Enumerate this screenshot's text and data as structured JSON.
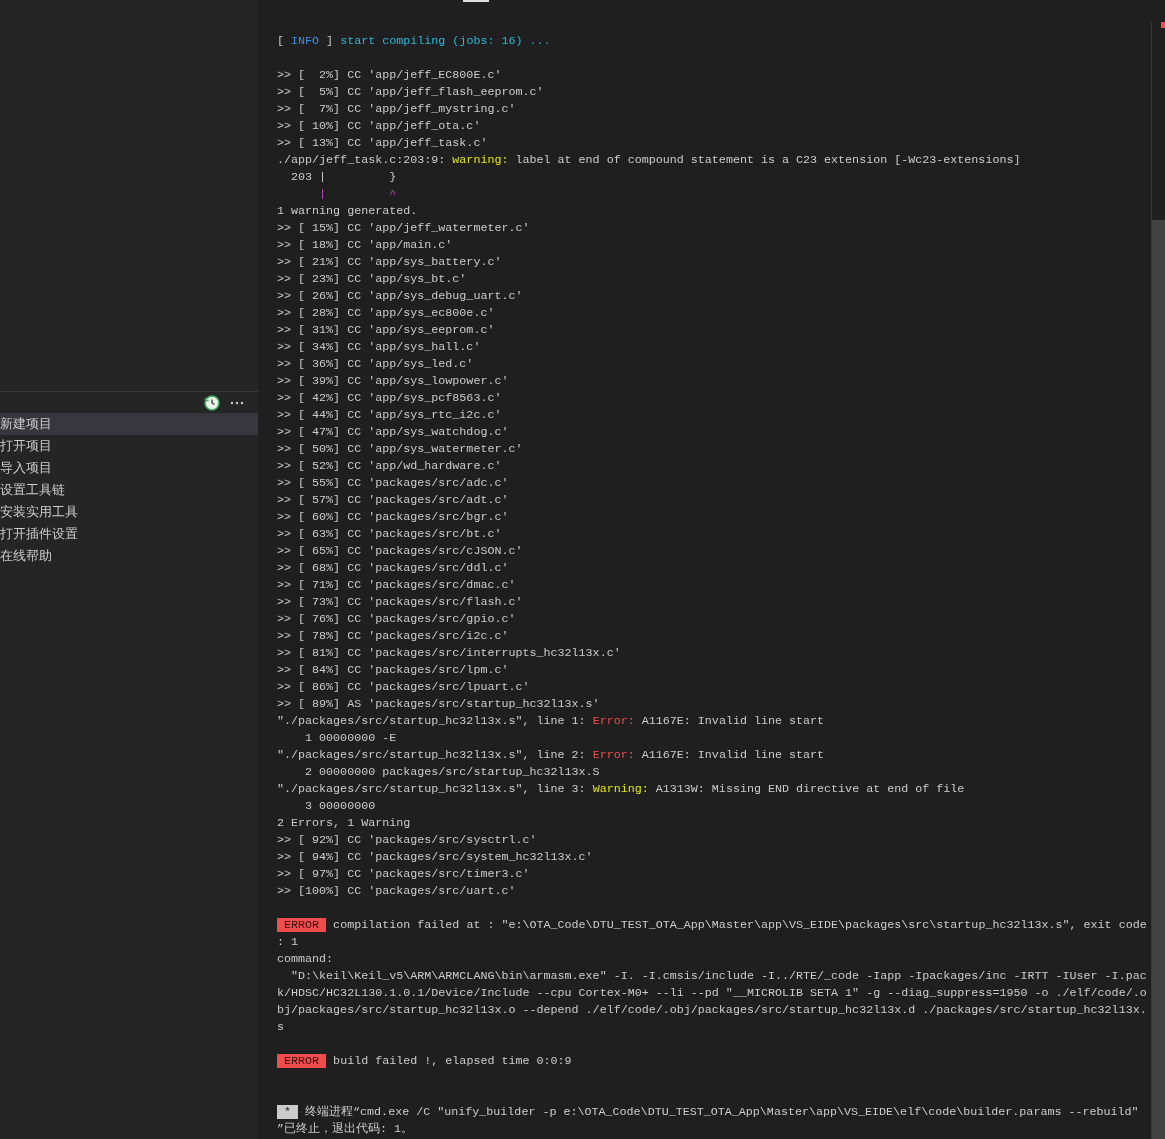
{
  "sidebar": {
    "items": [
      {
        "label": "新建项目",
        "selected": true
      },
      {
        "label": "打开项目",
        "selected": false
      },
      {
        "label": "导入项目",
        "selected": false
      },
      {
        "label": "设置工具链",
        "selected": false
      },
      {
        "label": "安装实用工具",
        "selected": false
      },
      {
        "label": "打开插件设置",
        "selected": false
      },
      {
        "label": "在线帮助",
        "selected": false
      }
    ]
  },
  "terminal": {
    "lines": [
      {
        "segments": [
          {
            "kind": "plain",
            "text": "[ "
          },
          {
            "kind": "info",
            "text": "INFO"
          },
          {
            "kind": "plain",
            "text": " ] "
          },
          {
            "kind": "cyan",
            "text": "start compiling (jobs: 16) ..."
          }
        ]
      },
      {
        "kind": "blank"
      },
      {
        "segments": [
          {
            "kind": "plain",
            "text": ">> [  2%] CC 'app/jeff_EC800E.c'"
          }
        ]
      },
      {
        "segments": [
          {
            "kind": "plain",
            "text": ">> [  5%] CC 'app/jeff_flash_eeprom.c'"
          }
        ]
      },
      {
        "segments": [
          {
            "kind": "plain",
            "text": ">> [  7%] CC 'app/jeff_mystring.c'"
          }
        ]
      },
      {
        "segments": [
          {
            "kind": "plain",
            "text": ">> [ 10%] CC 'app/jeff_ota.c'"
          }
        ]
      },
      {
        "segments": [
          {
            "kind": "plain",
            "text": ">> [ 13%] CC 'app/jeff_task.c'"
          }
        ]
      },
      {
        "segments": [
          {
            "kind": "plain",
            "text": "./app/jeff_task.c:203:9: "
          },
          {
            "kind": "warning",
            "text": "warning:"
          },
          {
            "kind": "plain",
            "text": " label at end of compound statement is a C23 extension [-Wc23-extensions]"
          }
        ]
      },
      {
        "segments": [
          {
            "kind": "plain",
            "text": "  203 |         }"
          }
        ]
      },
      {
        "segments": [
          {
            "kind": "marker",
            "text": "      |         ^"
          }
        ]
      },
      {
        "segments": [
          {
            "kind": "plain",
            "text": "1 warning generated."
          }
        ]
      },
      {
        "segments": [
          {
            "kind": "plain",
            "text": ">> [ 15%] CC 'app/jeff_watermeter.c'"
          }
        ]
      },
      {
        "segments": [
          {
            "kind": "plain",
            "text": ">> [ 18%] CC 'app/main.c'"
          }
        ]
      },
      {
        "segments": [
          {
            "kind": "plain",
            "text": ">> [ 21%] CC 'app/sys_battery.c'"
          }
        ]
      },
      {
        "segments": [
          {
            "kind": "plain",
            "text": ">> [ 23%] CC 'app/sys_bt.c'"
          }
        ]
      },
      {
        "segments": [
          {
            "kind": "plain",
            "text": ">> [ 26%] CC 'app/sys_debug_uart.c'"
          }
        ]
      },
      {
        "segments": [
          {
            "kind": "plain",
            "text": ">> [ 28%] CC 'app/sys_ec800e.c'"
          }
        ]
      },
      {
        "segments": [
          {
            "kind": "plain",
            "text": ">> [ 31%] CC 'app/sys_eeprom.c'"
          }
        ]
      },
      {
        "segments": [
          {
            "kind": "plain",
            "text": ">> [ 34%] CC 'app/sys_hall.c'"
          }
        ]
      },
      {
        "segments": [
          {
            "kind": "plain",
            "text": ">> [ 36%] CC 'app/sys_led.c'"
          }
        ]
      },
      {
        "segments": [
          {
            "kind": "plain",
            "text": ">> [ 39%] CC 'app/sys_lowpower.c'"
          }
        ]
      },
      {
        "segments": [
          {
            "kind": "plain",
            "text": ">> [ 42%] CC 'app/sys_pcf8563.c'"
          }
        ]
      },
      {
        "segments": [
          {
            "kind": "plain",
            "text": ">> [ 44%] CC 'app/sys_rtc_i2c.c'"
          }
        ]
      },
      {
        "segments": [
          {
            "kind": "plain",
            "text": ">> [ 47%] CC 'app/sys_watchdog.c'"
          }
        ]
      },
      {
        "segments": [
          {
            "kind": "plain",
            "text": ">> [ 50%] CC 'app/sys_watermeter.c'"
          }
        ]
      },
      {
        "segments": [
          {
            "kind": "plain",
            "text": ">> [ 52%] CC 'app/wd_hardware.c'"
          }
        ]
      },
      {
        "segments": [
          {
            "kind": "plain",
            "text": ">> [ 55%] CC 'packages/src/adc.c'"
          }
        ]
      },
      {
        "segments": [
          {
            "kind": "plain",
            "text": ">> [ 57%] CC 'packages/src/adt.c'"
          }
        ]
      },
      {
        "segments": [
          {
            "kind": "plain",
            "text": ">> [ 60%] CC 'packages/src/bgr.c'"
          }
        ]
      },
      {
        "segments": [
          {
            "kind": "plain",
            "text": ">> [ 63%] CC 'packages/src/bt.c'"
          }
        ]
      },
      {
        "segments": [
          {
            "kind": "plain",
            "text": ">> [ 65%] CC 'packages/src/cJSON.c'"
          }
        ]
      },
      {
        "segments": [
          {
            "kind": "plain",
            "text": ">> [ 68%] CC 'packages/src/ddl.c'"
          }
        ]
      },
      {
        "segments": [
          {
            "kind": "plain",
            "text": ">> [ 71%] CC 'packages/src/dmac.c'"
          }
        ]
      },
      {
        "segments": [
          {
            "kind": "plain",
            "text": ">> [ 73%] CC 'packages/src/flash.c'"
          }
        ]
      },
      {
        "segments": [
          {
            "kind": "plain",
            "text": ">> [ 76%] CC 'packages/src/gpio.c'"
          }
        ]
      },
      {
        "segments": [
          {
            "kind": "plain",
            "text": ">> [ 78%] CC 'packages/src/i2c.c'"
          }
        ]
      },
      {
        "segments": [
          {
            "kind": "plain",
            "text": ">> [ 81%] CC 'packages/src/interrupts_hc32l13x.c'"
          }
        ]
      },
      {
        "segments": [
          {
            "kind": "plain",
            "text": ">> [ 84%] CC 'packages/src/lpm.c'"
          }
        ]
      },
      {
        "segments": [
          {
            "kind": "plain",
            "text": ">> [ 86%] CC 'packages/src/lpuart.c'"
          }
        ]
      },
      {
        "segments": [
          {
            "kind": "plain",
            "text": ">> [ 89%] AS 'packages/src/startup_hc32l13x.s'"
          }
        ]
      },
      {
        "segments": [
          {
            "kind": "plain",
            "text": "\"./packages/src/startup_hc32l13x.s\", line 1: "
          },
          {
            "kind": "error",
            "text": "Error:"
          },
          {
            "kind": "plain",
            "text": " A1167E: Invalid line start"
          }
        ]
      },
      {
        "segments": [
          {
            "kind": "plain",
            "text": "    1 00000000 -E"
          }
        ]
      },
      {
        "segments": [
          {
            "kind": "plain",
            "text": "\"./packages/src/startup_hc32l13x.s\", line 2: "
          },
          {
            "kind": "error",
            "text": "Error:"
          },
          {
            "kind": "plain",
            "text": " A1167E: Invalid line start"
          }
        ]
      },
      {
        "segments": [
          {
            "kind": "plain",
            "text": "    2 00000000 packages/src/startup_hc32l13x.S"
          }
        ]
      },
      {
        "segments": [
          {
            "kind": "plain",
            "text": "\"./packages/src/startup_hc32l13x.s\", line 3: "
          },
          {
            "kind": "warning",
            "text": "Warning:"
          },
          {
            "kind": "plain",
            "text": " A1313W: Missing END directive at end of file"
          }
        ]
      },
      {
        "segments": [
          {
            "kind": "plain",
            "text": "    3 00000000"
          }
        ]
      },
      {
        "segments": [
          {
            "kind": "plain",
            "text": "2 Errors, 1 Warning"
          }
        ]
      },
      {
        "segments": [
          {
            "kind": "plain",
            "text": ">> [ 92%] CC 'packages/src/sysctrl.c'"
          }
        ]
      },
      {
        "segments": [
          {
            "kind": "plain",
            "text": ">> [ 94%] CC 'packages/src/system_hc32l13x.c'"
          }
        ]
      },
      {
        "segments": [
          {
            "kind": "plain",
            "text": ">> [ 97%] CC 'packages/src/timer3.c'"
          }
        ]
      },
      {
        "segments": [
          {
            "kind": "plain",
            "text": ">> [100%] CC 'packages/src/uart.c'"
          }
        ]
      },
      {
        "kind": "blank"
      },
      {
        "segments": [
          {
            "kind": "error_badge",
            "text": " ERROR "
          },
          {
            "kind": "plain",
            "text": " compilation failed at : \"e:\\OTA_Code\\DTU_TEST_OTA_App\\Master\\app\\VS_EIDE\\packages\\src\\startup_hc32l13x.s\", exit code"
          }
        ]
      },
      {
        "segments": [
          {
            "kind": "plain",
            "text": ": 1"
          }
        ]
      },
      {
        "segments": [
          {
            "kind": "plain",
            "text": "command:"
          }
        ]
      },
      {
        "segments": [
          {
            "kind": "plain",
            "text": "  \"D:\\keil\\Keil_v5\\ARM\\ARMCLANG\\bin\\armasm.exe\" -I. -I.cmsis/include -I../RTE/_code -Iapp -Ipackages/inc -IRTT -IUser -I.pac"
          }
        ]
      },
      {
        "segments": [
          {
            "kind": "plain",
            "text": "k/HDSC/HC32L130.1.0.1/Device/Include --cpu Cortex-M0+ --li --pd \"__MICROLIB SETA 1\" -g --diag_suppress=1950 -o ./elf/code/.o"
          }
        ]
      },
      {
        "segments": [
          {
            "kind": "plain",
            "text": "bj/packages/src/startup_hc32l13x.o --depend ./elf/code/.obj/packages/src/startup_hc32l13x.d ./packages/src/startup_hc32l13x."
          }
        ]
      },
      {
        "segments": [
          {
            "kind": "plain",
            "text": "s"
          }
        ]
      },
      {
        "kind": "blank"
      },
      {
        "segments": [
          {
            "kind": "error_badge",
            "text": " ERROR "
          },
          {
            "kind": "plain",
            "text": " build failed !, elapsed time 0:0:9"
          }
        ]
      },
      {
        "kind": "blank"
      },
      {
        "kind": "blank"
      },
      {
        "segments": [
          {
            "kind": "star_badge",
            "text": " * "
          },
          {
            "kind": "plain",
            "text": " 终端进程“cmd.exe /C \"unify_builder -p e:\\OTA_Code\\DTU_TEST_OTA_App\\Master\\app\\VS_EIDE\\elf\\code\\builder.params --rebuild\""
          }
        ]
      },
      {
        "segments": [
          {
            "kind": "plain",
            "text": "”已终止，退出代码: 1。"
          }
        ]
      }
    ]
  }
}
